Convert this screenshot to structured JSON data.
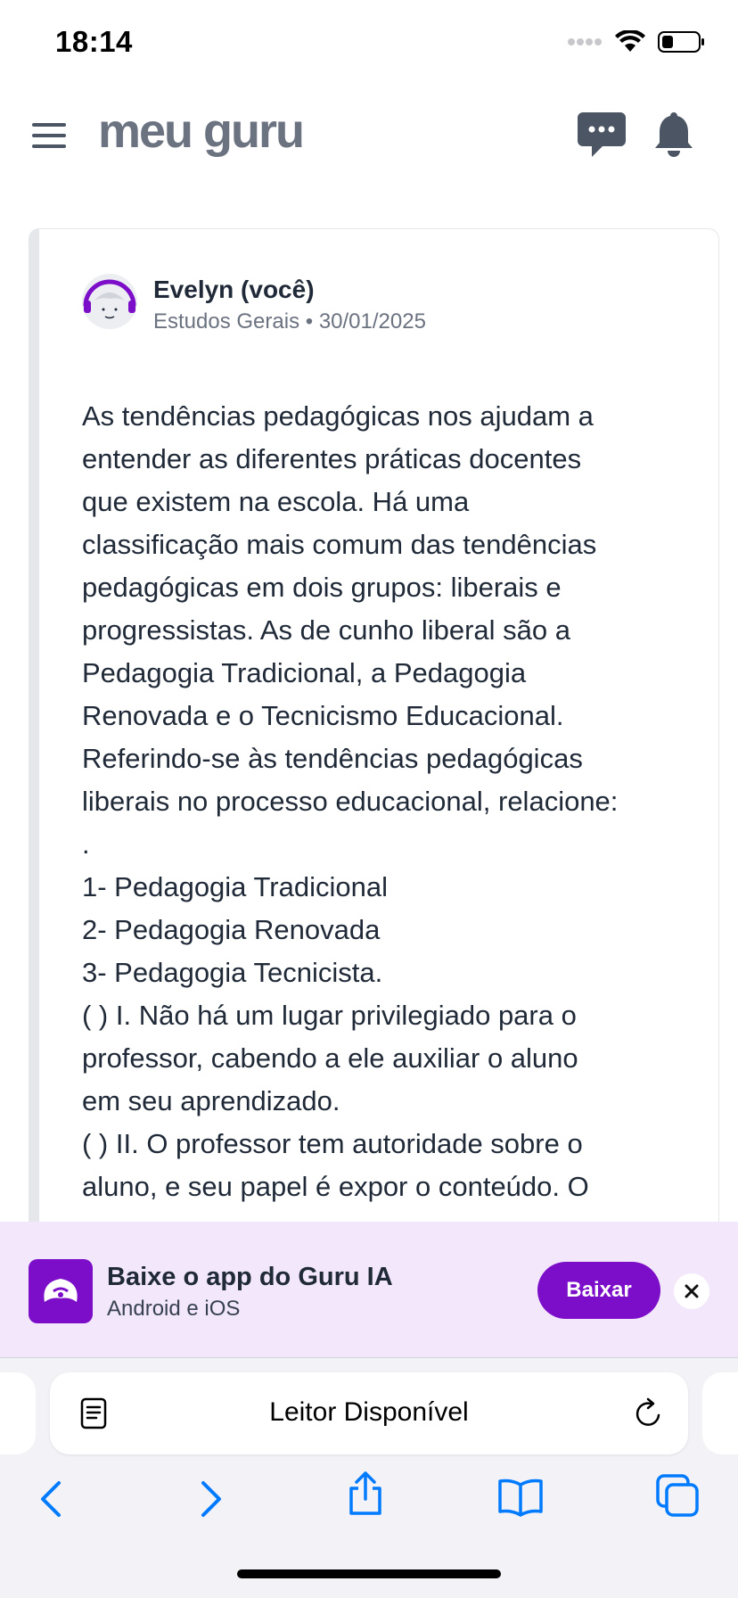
{
  "status_bar": {
    "time": "18:14"
  },
  "header": {
    "logo": "meu guru",
    "icons": [
      "menu-icon",
      "chat-icon",
      "bell-icon"
    ]
  },
  "post": {
    "author": "Evelyn (você)",
    "meta": "Estudos Gerais • 30/01/2025",
    "question": "As tendências pedagógicas nos ajudam a\nentender as diferentes práticas docentes\nque existem na escola. Há uma\nclassificação mais comum das tendências\npedagógicas em dois grupos: liberais e\nprogressistas. As de cunho liberal são a\nPedagogia Tradicional, a Pedagogia\nRenovada e o Tecnicismo Educacional.\nReferindo-se às tendências pedagógicas\nliberais no processo educacional, relacione:\n.\n1- Pedagogia Tradicional\n2- Pedagogia Renovada\n3- Pedagogia Tecnicista.\n( ) I. Não há um lugar privilegiado para o\nprofessor, cabendo a ele auxiliar o aluno\nem seu aprendizado.\n( ) II. O professor tem autoridade sobre o\naluno, e seu papel é expor o conteúdo. O"
  },
  "banner": {
    "title": "Baixe o app do Guru IA",
    "subtitle": "Android e iOS",
    "button": "Baixar"
  },
  "safari": {
    "url_text": "Leitor Disponível"
  },
  "colors": {
    "brand_purple": "#7c0dc9",
    "banner_bg": "#f3e8fb"
  }
}
